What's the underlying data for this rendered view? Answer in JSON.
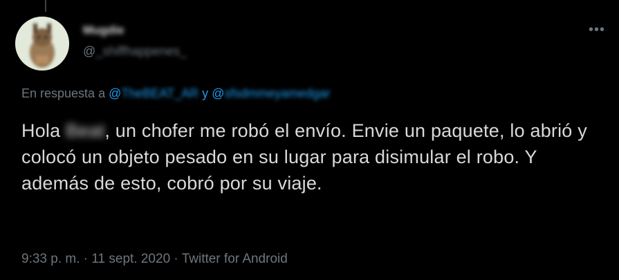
{
  "tweet": {
    "author": {
      "display_name": "Mugdie",
      "handle_prefix": "@",
      "handle": "_shiffhappenes_"
    },
    "more_icon": "more-horizontal-icon",
    "reply": {
      "label": "En respuesta a",
      "first_mention_at": "@",
      "first_mention": "TheBEAT_AR",
      "joiner": "y",
      "second_mention_at": "@",
      "second_mention": "sfsdmmeyamedgar"
    },
    "text": {
      "greeting": "Hola",
      "redacted_name": "Beat",
      "body": ", un chofer me robó el envío. Envie un paquete, lo abrió y colocó un objeto pesado en su lugar para disimular el robo. Y además de esto, cobró por su viaje."
    },
    "meta": {
      "time": "9:33 p. m.",
      "sep1": "·",
      "date": "11 sept. 2020",
      "sep2": "·",
      "source": "Twitter for Android"
    }
  },
  "colors": {
    "background": "#000000",
    "text": "#d9d9d9",
    "muted": "#6e767d",
    "link": "#1d9bf0"
  }
}
